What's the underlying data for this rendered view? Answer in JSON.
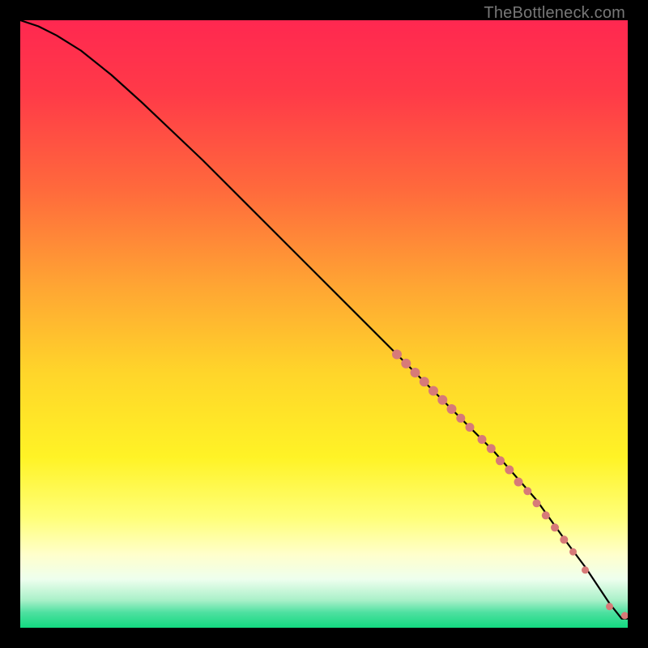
{
  "watermark": "TheBottleneck.com",
  "chart_data": {
    "type": "line",
    "title": "",
    "xlabel": "",
    "ylabel": "",
    "xlim": [
      0,
      100
    ],
    "ylim": [
      0,
      100
    ],
    "grid": false,
    "legend": false,
    "background_gradient": {
      "stops": [
        {
          "offset": 0.0,
          "color": "#ff2850"
        },
        {
          "offset": 0.12,
          "color": "#ff3a48"
        },
        {
          "offset": 0.28,
          "color": "#ff6a3c"
        },
        {
          "offset": 0.44,
          "color": "#ffa633"
        },
        {
          "offset": 0.58,
          "color": "#ffd52a"
        },
        {
          "offset": 0.72,
          "color": "#fff326"
        },
        {
          "offset": 0.82,
          "color": "#ffff7a"
        },
        {
          "offset": 0.88,
          "color": "#ffffcc"
        },
        {
          "offset": 0.92,
          "color": "#eeffee"
        },
        {
          "offset": 0.955,
          "color": "#a8f0c8"
        },
        {
          "offset": 0.975,
          "color": "#4ee0a0"
        },
        {
          "offset": 1.0,
          "color": "#12d980"
        }
      ]
    },
    "series": [
      {
        "name": "curve",
        "x": [
          0,
          3,
          6,
          10,
          15,
          20,
          30,
          40,
          50,
          60,
          70,
          78,
          85,
          90,
          93,
          95,
          97,
          99,
          100
        ],
        "y": [
          100,
          99,
          97.5,
          95,
          91,
          86.5,
          77,
          67,
          57,
          47,
          37,
          29,
          21,
          14,
          10,
          7,
          4,
          1.5,
          1.5
        ]
      }
    ],
    "markers": {
      "name": "dots",
      "color": "#d77a78",
      "points": [
        {
          "x": 62,
          "y": 45,
          "r": 6
        },
        {
          "x": 63.5,
          "y": 43.5,
          "r": 6
        },
        {
          "x": 65,
          "y": 42,
          "r": 6
        },
        {
          "x": 66.5,
          "y": 40.5,
          "r": 6
        },
        {
          "x": 68,
          "y": 39,
          "r": 6
        },
        {
          "x": 69.5,
          "y": 37.5,
          "r": 6
        },
        {
          "x": 71,
          "y": 36,
          "r": 6
        },
        {
          "x": 72.5,
          "y": 34.5,
          "r": 5.5
        },
        {
          "x": 74,
          "y": 33,
          "r": 5.5
        },
        {
          "x": 76,
          "y": 31,
          "r": 5.5
        },
        {
          "x": 77.5,
          "y": 29.5,
          "r": 5.5
        },
        {
          "x": 79,
          "y": 27.5,
          "r": 5.5
        },
        {
          "x": 80.5,
          "y": 26,
          "r": 5.5
        },
        {
          "x": 82,
          "y": 24,
          "r": 5.5
        },
        {
          "x": 83.5,
          "y": 22.5,
          "r": 5
        },
        {
          "x": 85,
          "y": 20.5,
          "r": 5
        },
        {
          "x": 86.5,
          "y": 18.5,
          "r": 5
        },
        {
          "x": 88,
          "y": 16.5,
          "r": 5
        },
        {
          "x": 89.5,
          "y": 14.5,
          "r": 5
        },
        {
          "x": 91,
          "y": 12.5,
          "r": 4.5
        },
        {
          "x": 93,
          "y": 9.5,
          "r": 4.5
        },
        {
          "x": 97,
          "y": 3.5,
          "r": 4.5
        },
        {
          "x": 99.5,
          "y": 2,
          "r": 4.5
        },
        {
          "x": 100.5,
          "y": 2,
          "r": 4.5
        }
      ]
    }
  }
}
